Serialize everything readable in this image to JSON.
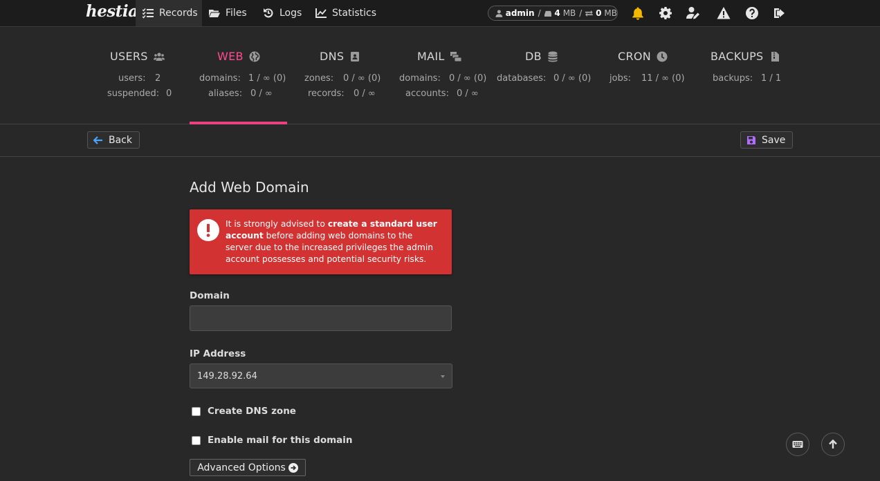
{
  "app": {
    "logo_text": "hestia"
  },
  "nav": {
    "records_label": "Records",
    "files_label": "Files",
    "logs_label": "Logs",
    "statistics_label": "Statistics"
  },
  "usage": {
    "user": "admin",
    "disk": "4",
    "disk_unit": "MB",
    "bandwidth": "0",
    "bandwidth_unit": "MB"
  },
  "stats": {
    "users": {
      "title": "USERS",
      "l1": "users:",
      "v1": "2",
      "l2": "suspended:",
      "v2": "0"
    },
    "web": {
      "title": "WEB",
      "l1": "domains:",
      "v1": "1 / ∞ (0)",
      "l2": "aliases:",
      "v2": "0 / ∞"
    },
    "dns": {
      "title": "DNS",
      "l1": "zones:",
      "v1": "0 / ∞ (0)",
      "l2": "records:",
      "v2": "0 / ∞"
    },
    "mail": {
      "title": "MAIL",
      "l1": "domains:",
      "v1": "0 / ∞ (0)",
      "l2": "accounts:",
      "v2": "0 / ∞"
    },
    "db": {
      "title": "DB",
      "l1": "databases:",
      "v1": "0 / ∞ (0)"
    },
    "cron": {
      "title": "CRON",
      "l1": "jobs:",
      "v1": "11 / ∞ (0)"
    },
    "backups": {
      "title": "BACKUPS",
      "l1": "backups:",
      "v1": "1 / 1"
    }
  },
  "toolbar": {
    "back_label": "Back",
    "save_label": "Save"
  },
  "form": {
    "title": "Add Web Domain",
    "alert_pre": "It is strongly advised to ",
    "alert_bold": "create a standard user account",
    "alert_post": " before adding web domains to the server due to the increased privileges the admin account possesses and potential security risks.",
    "domain_label": "Domain",
    "domain_value": "",
    "ip_label": "IP Address",
    "ip_value": "149.28.92.64",
    "dns_label": "Create DNS zone",
    "mail_label": "Enable mail for this domain",
    "advanced_label": "Advanced Options"
  },
  "colors": {
    "accent": "#e9437e",
    "alert": "#d33232",
    "bell": "#f5b800",
    "purple": "#b06bff"
  }
}
